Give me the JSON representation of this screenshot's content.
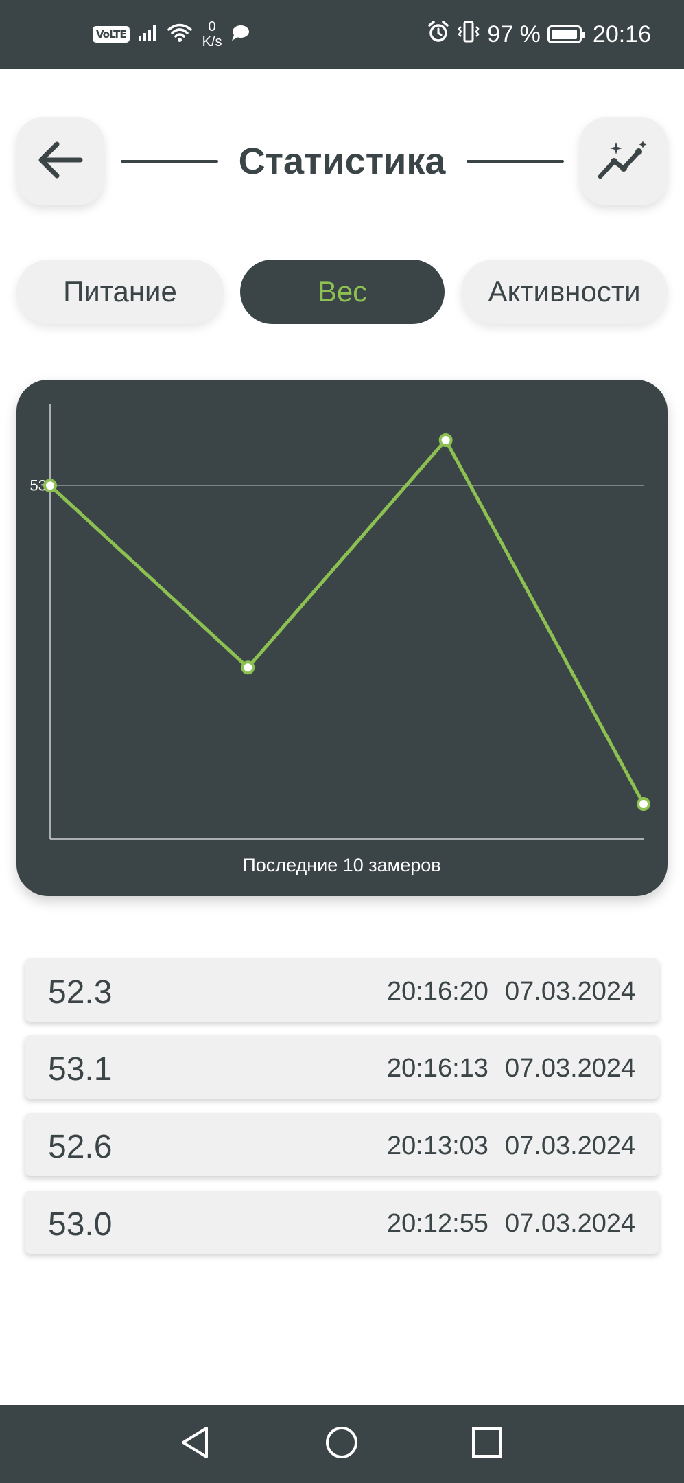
{
  "status_bar": {
    "volte": "VoLTE",
    "net_speed_value": "0",
    "net_speed_unit": "K/s",
    "battery_percent": "97 %",
    "battery_level": 0.97,
    "time": "20:16"
  },
  "header": {
    "title": "Статистика",
    "back_icon": "arrow-left-icon",
    "stats_icon": "sparkle-chart-icon"
  },
  "tabs": [
    {
      "label": "Питание",
      "active": false
    },
    {
      "label": "Вес",
      "active": true
    },
    {
      "label": "Активности",
      "active": false
    }
  ],
  "colors": {
    "primary_dark": "#3b4447",
    "accent_green": "#8cc152",
    "light_surface": "#f0f0f0"
  },
  "chart_data": {
    "type": "line",
    "title": "",
    "xlabel": "Последние 10 замеров",
    "ylabel": "",
    "y_tick_labels": [
      "53"
    ],
    "y_ticks": [
      53
    ],
    "ylim": [
      52.3,
      53.1
    ],
    "grid": "horizontal line at 53",
    "legend": "none",
    "series": [
      {
        "values": [
          53.0,
          52.6,
          53.1,
          52.3
        ]
      }
    ]
  },
  "records": [
    {
      "value": "52.3",
      "time": "20:16:20",
      "date": "07.03.2024"
    },
    {
      "value": "53.1",
      "time": "20:16:13",
      "date": "07.03.2024"
    },
    {
      "value": "52.6",
      "time": "20:13:03",
      "date": "07.03.2024"
    },
    {
      "value": "53.0",
      "time": "20:12:55",
      "date": "07.03.2024"
    }
  ],
  "nav_bar": {
    "back_icon": "nav-back-triangle-icon",
    "home_icon": "nav-home-circle-icon",
    "recents_icon": "nav-recents-square-icon"
  }
}
